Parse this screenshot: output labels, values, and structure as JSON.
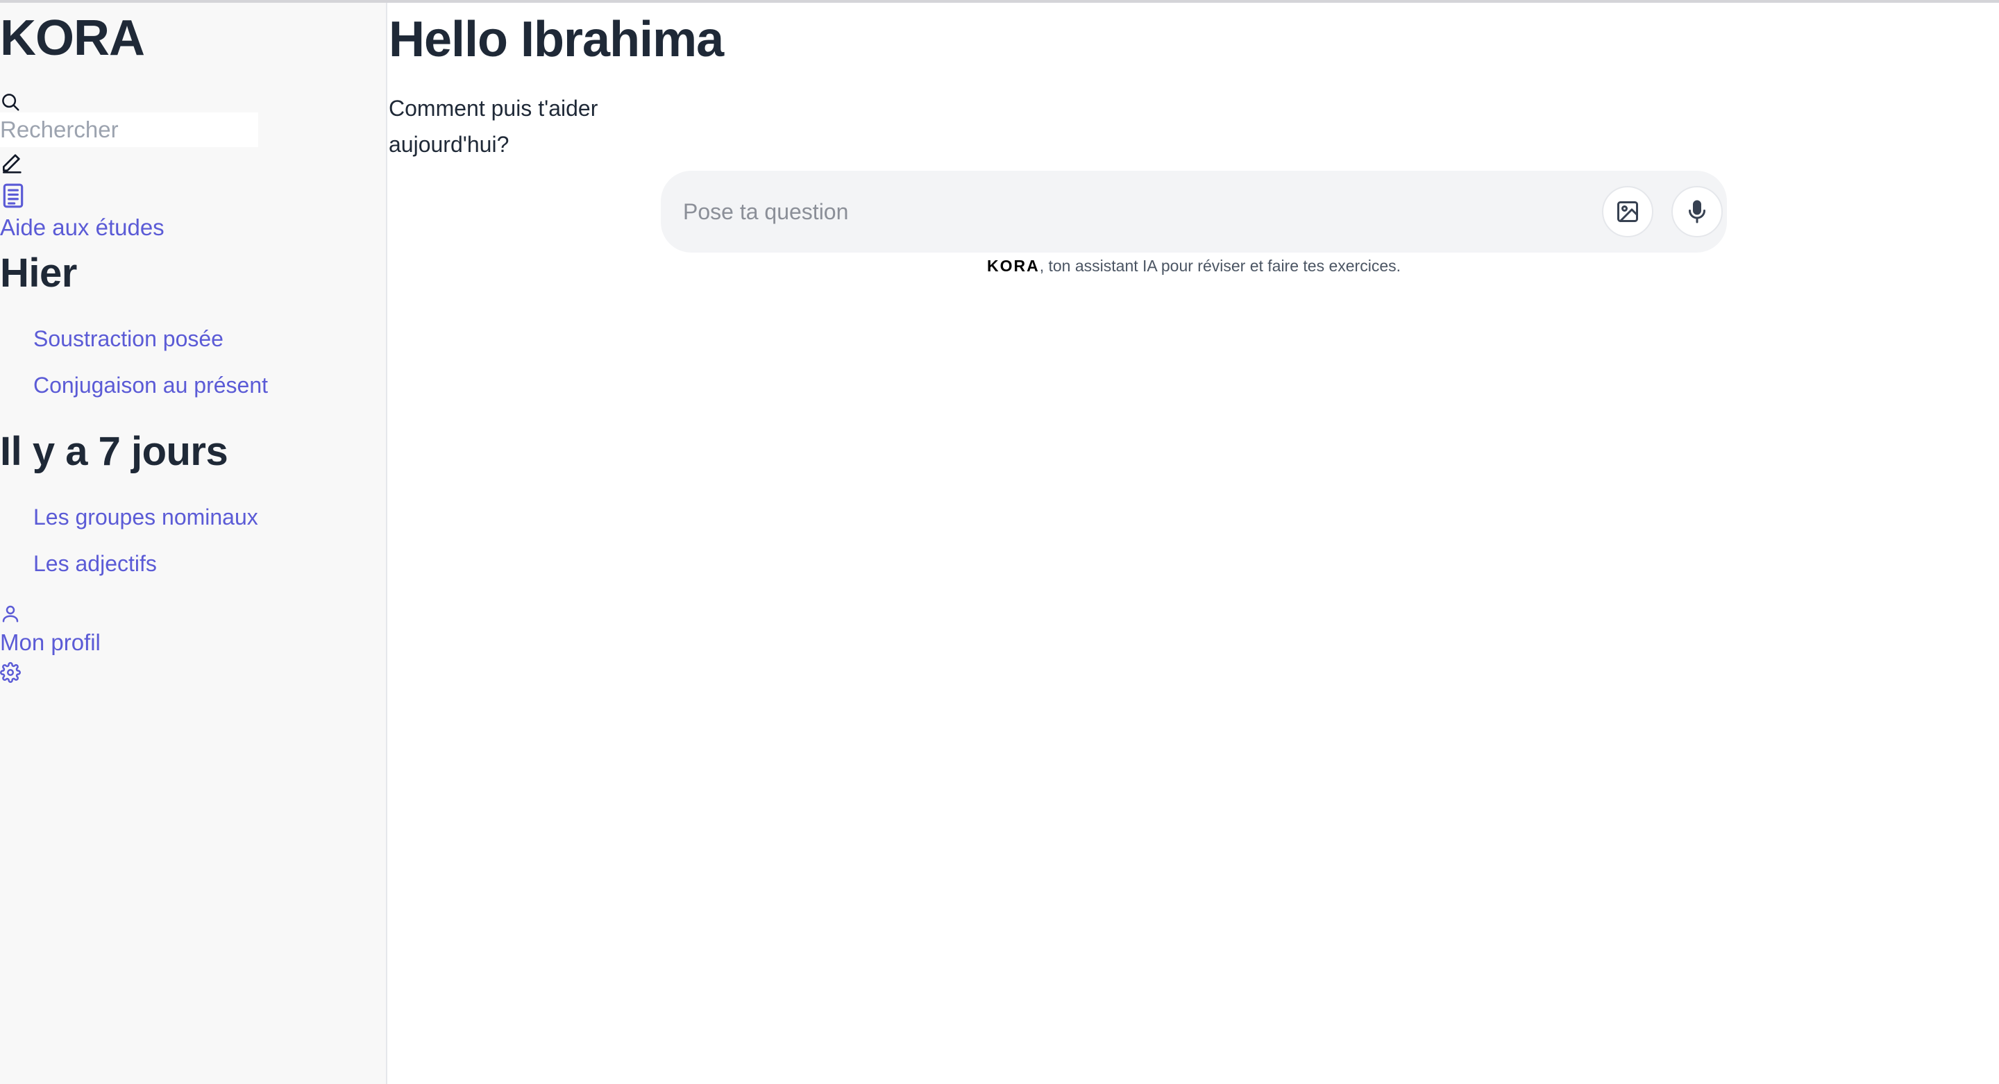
{
  "colors": {
    "accent": "#5b5bd6",
    "text": "#1f2937",
    "sidebar_bg": "#f8f8f8",
    "composer_bg": "#f3f4f6"
  },
  "sidebar": {
    "brand": "KORA",
    "search": {
      "placeholder": "Rechercher",
      "icon": "search-icon"
    },
    "new_chat_icon": "pencil-icon",
    "study_help": {
      "icon": "document-icon",
      "label": "Aide aux études"
    },
    "sections": [
      {
        "title": "Hier",
        "items": [
          "Soustraction posée",
          "Conjugaison au présent"
        ]
      },
      {
        "title": "Il y a 7 jours",
        "items": [
          "Les groupes nominaux",
          "Les adjectifs"
        ]
      }
    ],
    "profile": {
      "icon": "user-icon",
      "label": "Mon profil"
    },
    "settings_icon": "gear-icon"
  },
  "main": {
    "greeting": "Hello Ibrahima",
    "subtitle": "Comment puis t'aider aujourd'hui?",
    "composer": {
      "placeholder": "Pose ta question",
      "image_button_icon": "image-icon",
      "mic_button_icon": "microphone-icon"
    },
    "disclaimer": {
      "brand": "KORA",
      "text": ", ton assistant IA pour réviser et faire tes exercices."
    }
  }
}
